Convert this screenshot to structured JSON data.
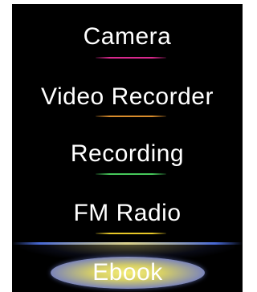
{
  "menu": {
    "items": [
      {
        "label": "Camera",
        "accent": "#d8288c"
      },
      {
        "label": "Video Recorder",
        "accent": "#d88c2c"
      },
      {
        "label": "Recording",
        "accent": "#46c85a"
      },
      {
        "label": "FM Radio",
        "accent": "#e8c828"
      }
    ],
    "selected": {
      "label": "Ebook",
      "accent": "#4a6ee0"
    }
  },
  "colors": {
    "background": "#000000",
    "text": "#ffffff"
  }
}
